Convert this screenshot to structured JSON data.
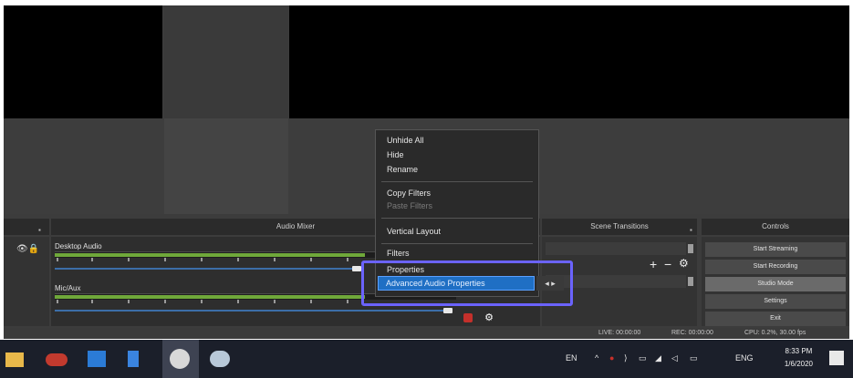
{
  "mixer": {
    "title": "Audio Mixer",
    "channels": [
      {
        "name": "Desktop Audio"
      },
      {
        "name": "Mic/Aux"
      }
    ]
  },
  "docks": {
    "transitions_title": "Scene Transitions",
    "controls_title": "Controls"
  },
  "controls": {
    "buttons": [
      "Start Streaming",
      "Start Recording",
      "Studio Mode",
      "Settings",
      "Exit"
    ]
  },
  "context_menu": {
    "items": [
      "Unhide All",
      "Hide",
      "Rename",
      "Copy Filters",
      "Paste Filters",
      "Vertical Layout",
      "Filters",
      "Properties",
      "Advanced Audio Properties"
    ],
    "disabled": [
      "Paste Filters"
    ],
    "selected": "Advanced Audio Properties"
  },
  "status": {
    "live": "LIVE: 00:00:00",
    "rec": "REC: 00:00:00",
    "cpu": "CPU: 0.2%, 30.00 fps"
  },
  "taskbar": {
    "language_short": "EN",
    "language": "ENG",
    "time": "8:33 PM",
    "date": "1/6/2020"
  },
  "colors": {
    "accent_highlight": "#6b63ff",
    "menu_selected": "#1f6fc4",
    "meter_green": "#6fa83a",
    "mute_red": "#c4302b"
  }
}
